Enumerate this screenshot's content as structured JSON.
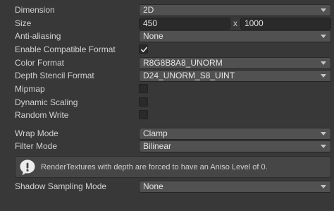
{
  "fields": {
    "dimension": {
      "label": "Dimension",
      "value": "2D"
    },
    "size": {
      "label": "Size",
      "width": "450",
      "separator": "x",
      "height": "1000"
    },
    "anti_aliasing": {
      "label": "Anti-aliasing",
      "value": "None"
    },
    "enable_compatible_format": {
      "label": "Enable Compatible Format",
      "checked": true
    },
    "color_format": {
      "label": "Color Format",
      "value": "R8G8B8A8_UNORM"
    },
    "depth_stencil_format": {
      "label": "Depth Stencil Format",
      "value": "D24_UNORM_S8_UINT"
    },
    "mipmap": {
      "label": "Mipmap",
      "checked": false
    },
    "dynamic_scaling": {
      "label": "Dynamic Scaling",
      "checked": false
    },
    "random_write": {
      "label": "Random Write",
      "checked": false
    },
    "wrap_mode": {
      "label": "Wrap Mode",
      "value": "Clamp"
    },
    "filter_mode": {
      "label": "Filter Mode",
      "value": "Bilinear"
    },
    "shadow_sampling_mode": {
      "label": "Shadow Sampling Mode",
      "value": "None"
    }
  },
  "help_box": {
    "icon": "warning-icon",
    "text": "RenderTextures with depth are forced to have an Aniso Level of 0."
  },
  "colors": {
    "background": "#383838",
    "dropdown": "#515151",
    "text_field": "#2a2a2a",
    "text": "#d2d2d2"
  }
}
